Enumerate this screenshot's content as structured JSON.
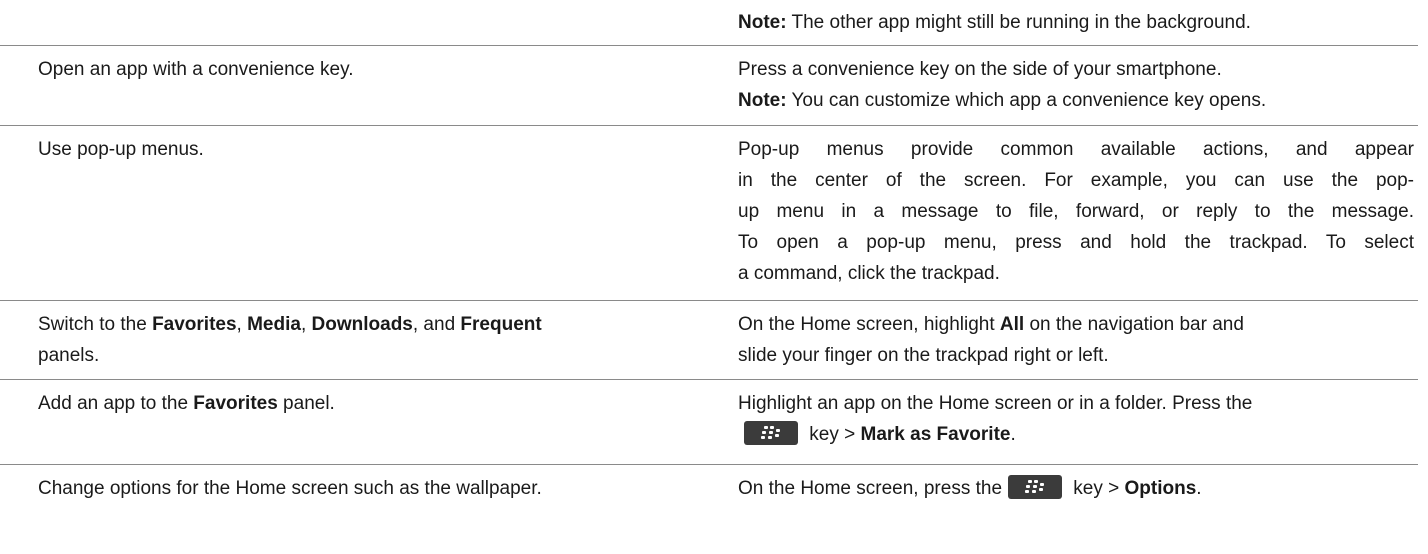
{
  "rows": [
    {
      "task": "",
      "desc_note_label": "Note:",
      "desc_note_text": " The other app might still be running in the background."
    },
    {
      "task": "Open an app with a convenience key.",
      "desc": "Press a convenience key on the side of your smartphone.",
      "note_label": "Note:",
      "note_text": " You can customize which app a convenience key opens."
    },
    {
      "task": "Use pop-up menus.",
      "desc_lines": [
        "Pop-up menus provide common available actions, and appear",
        "in the center of the screen. For example, you can use the pop-",
        "up menu in a message to file, forward, or reply to the message.",
        "To open a pop-up menu, press and hold the trackpad. To select",
        "a command, click the trackpad."
      ]
    },
    {
      "task_prefix": "Switch to the ",
      "task_b1": "Favorites",
      "task_sep1": ", ",
      "task_b2": "Media",
      "task_sep2": ", ",
      "task_b3": "Downloads",
      "task_sep3": ", and ",
      "task_b4": "Frequent",
      "task_line2": "panels.",
      "desc_prefix": "On the Home screen, highlight ",
      "desc_b1": "All",
      "desc_mid": " on the navigation bar and",
      "desc_line2": "slide your finger on the trackpad right or left."
    },
    {
      "task_prefix": "Add an app to the ",
      "task_b1": "Favorites",
      "task_suffix": " panel.",
      "desc_line1": "Highlight an app on the Home screen or in a folder. Press the",
      "desc_key_text": " key > ",
      "desc_b1": "Mark as Favorite",
      "desc_end": "."
    },
    {
      "task": "Change options for the Home screen such as the wallpaper.",
      "desc_prefix": "On the Home screen, press the",
      "desc_key_text": " key > ",
      "desc_b1": "Options",
      "desc_end": "."
    }
  ],
  "icons": {
    "menu_key": "blackberry-menu-key-icon"
  },
  "colors": {
    "text": "#1a1a1a",
    "rule": "#8a8a8a",
    "key_bg": "#3b3b3b"
  }
}
